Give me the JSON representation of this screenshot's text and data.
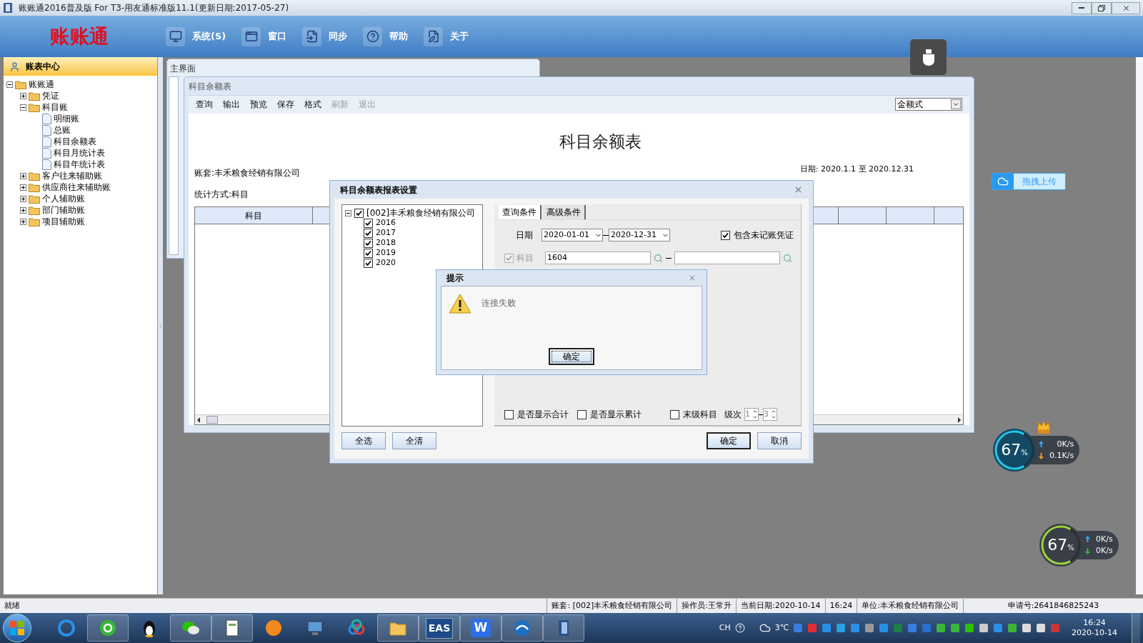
{
  "window": {
    "title": "账账通2016普及版 For T3-用友通标准版11.1(更新日期:2017-05-27)"
  },
  "logo": "账账通",
  "menu": [
    {
      "label": "系统(S)"
    },
    {
      "label": "窗口"
    },
    {
      "label": "同步"
    },
    {
      "label": "帮助"
    },
    {
      "label": "关于"
    }
  ],
  "sidebar": {
    "title": "账表中心",
    "tree": [
      {
        "label": "账账通",
        "kind": "folder",
        "expanded": true,
        "children": [
          {
            "label": "凭证",
            "kind": "folder",
            "expanded": false
          },
          {
            "label": "科目账",
            "kind": "folder",
            "expanded": true,
            "children": [
              {
                "label": "明细账",
                "kind": "page"
              },
              {
                "label": "总账",
                "kind": "page"
              },
              {
                "label": "科目余额表",
                "kind": "page"
              },
              {
                "label": "科目月统计表",
                "kind": "page"
              },
              {
                "label": "科目年统计表",
                "kind": "page"
              }
            ]
          },
          {
            "label": "客户往来辅助账",
            "kind": "folder",
            "expanded": false
          },
          {
            "label": "供应商往来辅助账",
            "kind": "folder",
            "expanded": false
          },
          {
            "label": "个人辅助账",
            "kind": "folder",
            "expanded": false
          },
          {
            "label": "部门辅助账",
            "kind": "folder",
            "expanded": false
          },
          {
            "label": "项目辅助账",
            "kind": "folder",
            "expanded": false
          }
        ]
      }
    ]
  },
  "main_tab": {
    "title": "主界面"
  },
  "report_window": {
    "title": "科目余额表",
    "toolbar": [
      {
        "label": "查询",
        "disabled": false
      },
      {
        "label": "输出",
        "disabled": false
      },
      {
        "label": "预览",
        "disabled": false
      },
      {
        "label": "保存",
        "disabled": false
      },
      {
        "label": "格式",
        "disabled": false
      },
      {
        "label": "刷新",
        "disabled": true
      },
      {
        "label": "退出",
        "disabled": true
      }
    ],
    "format_select": "金额式",
    "heading": "科目余额表",
    "account_set": "账套:丰禾粮食经销有限公司",
    "date_range": "日期: 2020.1.1 至 2020.12.31",
    "stat_mode": "统计方式:科目",
    "columns": [
      "科目"
    ]
  },
  "settings_dialog": {
    "title": "科目余额表报表设置",
    "tree": {
      "label": "[002]丰禾粮食经销有限公司",
      "checked": true,
      "expanded": true,
      "children": [
        {
          "label": "2016",
          "checked": true
        },
        {
          "label": "2017",
          "checked": true
        },
        {
          "label": "2018",
          "checked": true
        },
        {
          "label": "2019",
          "checked": true
        },
        {
          "label": "2020",
          "checked": true
        }
      ]
    },
    "tabs": [
      {
        "label": "查询条件",
        "selected": true
      },
      {
        "label": "高级条件",
        "selected": false
      }
    ],
    "date_label": "日期",
    "date_from": "2020-01-01",
    "date_to": "2020-12-31",
    "include_unposted": {
      "label": "包含未记账凭证",
      "checked": true
    },
    "subject": {
      "label": "科目",
      "checked": true,
      "disabled": true,
      "from": "1604"
    },
    "options": [
      {
        "label": "是否显示合计",
        "checked": false
      },
      {
        "label": "是否显示累计",
        "checked": false
      },
      {
        "label": "末级科目",
        "checked": false
      }
    ],
    "level_label": "级次",
    "level_from": "1",
    "level_to": "3",
    "left_buttons": [
      "全选",
      "全清"
    ],
    "buttons": [
      "确定",
      "取消"
    ]
  },
  "alert": {
    "title": "提示",
    "message": "连接失败",
    "button": "确定"
  },
  "upload_button": "拖拽上传",
  "speed_widgets": [
    {
      "percent": "67",
      "unit": "%",
      "level": 0.67,
      "up": "0K/s",
      "down": "0.1K/s",
      "vip": true
    },
    {
      "percent": "67",
      "unit": "%",
      "level": 0.67,
      "up": "0K/s",
      "down": "0K/s",
      "vip": false
    }
  ],
  "status_bar": [
    "就绪",
    "账套: [002]丰禾粮食经销有限公司",
    "操作员:王常升",
    "当前日期:2020-10-14",
    "16:24",
    "单位:丰禾粮食经销有限公司",
    "申请号:2641846825243"
  ],
  "taskbar": {
    "eas_label": "EAS",
    "wps_label": "W",
    "language": "CH",
    "temperature": "3℃",
    "time": "16:24",
    "date": "2020-10-14"
  }
}
